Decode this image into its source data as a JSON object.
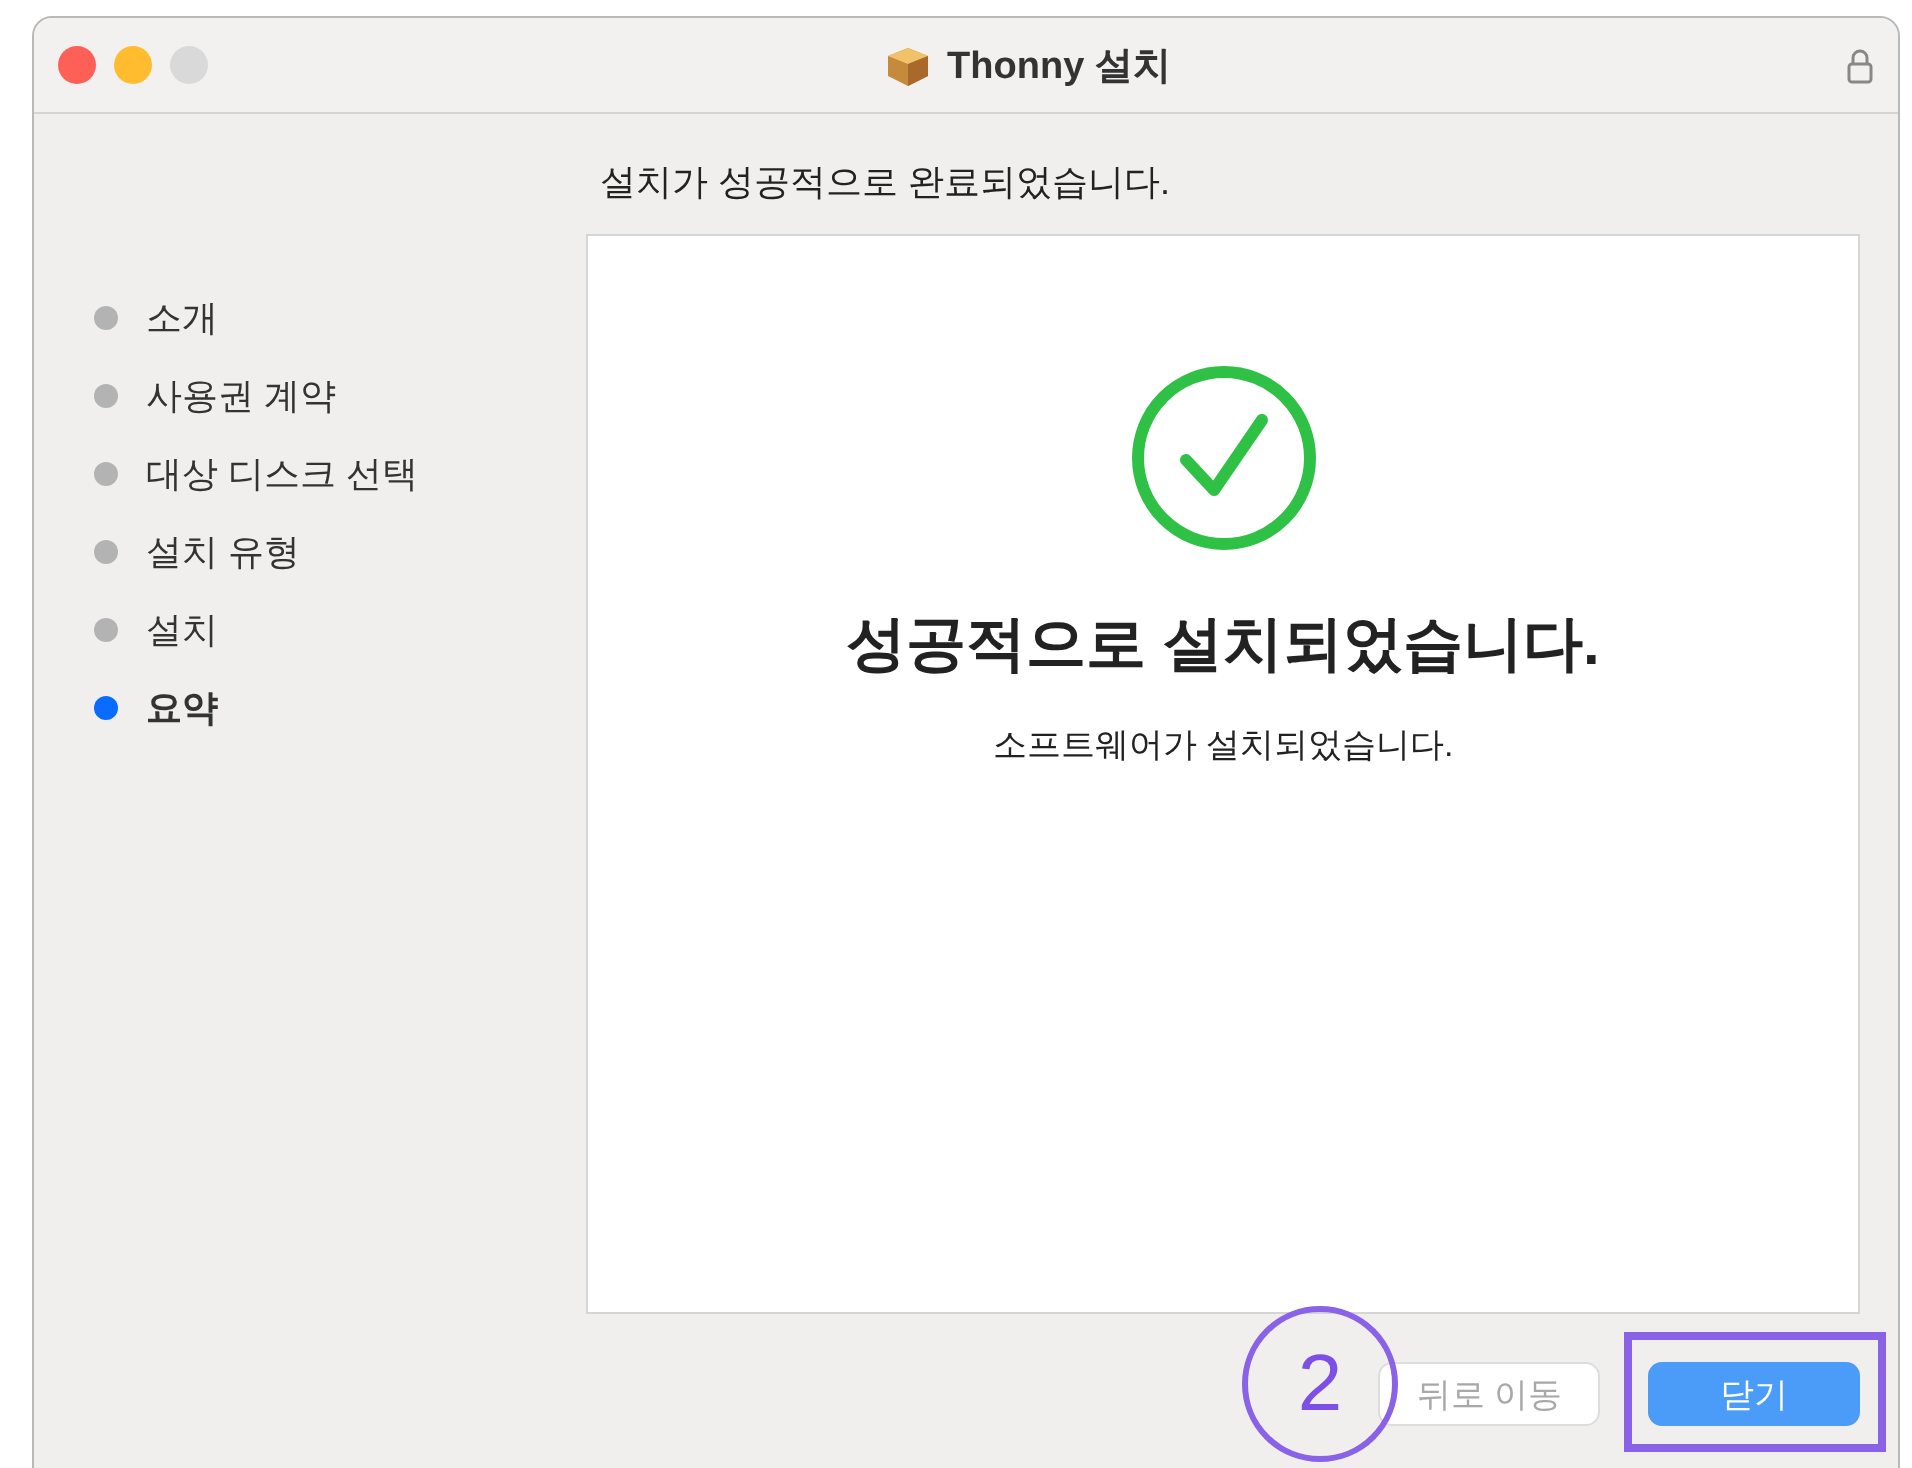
{
  "window": {
    "title": "Thonny 설치"
  },
  "steps": [
    {
      "label": "소개",
      "selected": false
    },
    {
      "label": "사용권 계약",
      "selected": false
    },
    {
      "label": "대상 디스크 선택",
      "selected": false
    },
    {
      "label": "설치 유형",
      "selected": false
    },
    {
      "label": "설치",
      "selected": false
    },
    {
      "label": "요약",
      "selected": true
    }
  ],
  "heading": "설치가 성공적으로 완료되었습니다.",
  "panel": {
    "title": "성공적으로 설치되었습니다.",
    "message": "소프트웨어가 설치되었습니다."
  },
  "buttons": [
    {
      "label": "뒤로 이동",
      "kind": "secondary",
      "disabled": true
    },
    {
      "label": "닫기",
      "kind": "primary",
      "disabled": false
    }
  ],
  "annotation": {
    "number": "2"
  }
}
